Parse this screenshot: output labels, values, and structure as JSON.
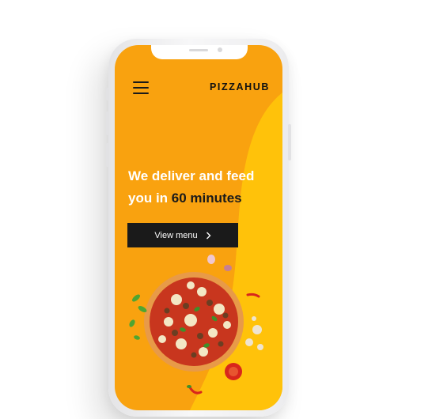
{
  "header": {
    "brand": "PIZZAHUB",
    "menu_icon": "hamburger-menu-icon"
  },
  "hero": {
    "headline_line1": "We deliver and feed",
    "headline_prefix": "you in",
    "headline_accent": "60 minutes",
    "cta_label": "View menu",
    "cta_icon": "chevron-right-icon"
  },
  "colors": {
    "primary": "#f9a20f",
    "secondary": "#ffc20a",
    "dark": "#1a1a1a",
    "text_light": "#ffffff"
  }
}
